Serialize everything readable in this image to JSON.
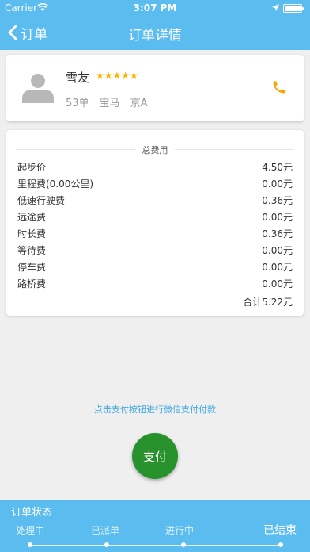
{
  "status_bar": {
    "carrier": "Carrier",
    "time": "3:07 PM"
  },
  "nav": {
    "back_label": "订单",
    "title": "订单详情"
  },
  "driver": {
    "name": "雪友",
    "stars": "★★★★★",
    "orders": "53单",
    "car": "宝马",
    "plate": "京A"
  },
  "fees": {
    "title": "总费用",
    "items": [
      {
        "label": "起步价",
        "value": "4.50元"
      },
      {
        "label": "里程费(0.00公里)",
        "value": "0.00元"
      },
      {
        "label": "低速行驶费",
        "value": "0.36元"
      },
      {
        "label": "远途费",
        "value": "0.00元"
      },
      {
        "label": "时长费",
        "value": "0.36元"
      },
      {
        "label": "等待费",
        "value": "0.00元"
      },
      {
        "label": "停车费",
        "value": "0.00元"
      },
      {
        "label": "路桥费",
        "value": "0.00元"
      }
    ],
    "total": "合计5.22元"
  },
  "pay": {
    "hint": "点击支付按钮进行微信支付付款",
    "button_label": "支付",
    "button_color": "#27912c"
  },
  "order_status": {
    "title": "订单状态",
    "steps": [
      "处理中",
      "已派单",
      "进行中",
      "已结束"
    ],
    "active_step": 3
  },
  "colors": {
    "primary": "#5bbcf0",
    "star": "#f5b300",
    "phone": "#f5a800"
  }
}
